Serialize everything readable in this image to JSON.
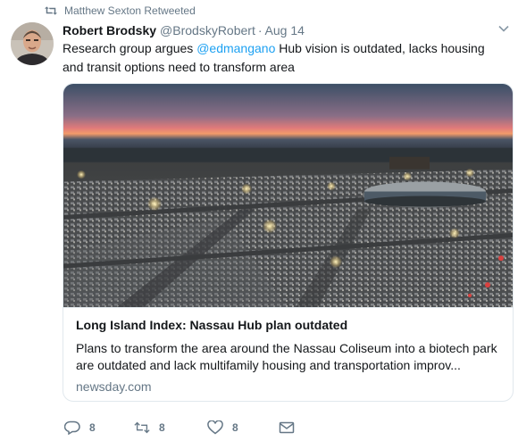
{
  "retweet_context": {
    "text": "Matthew Sexton Retweeted",
    "icon": "retweet-icon"
  },
  "tweet": {
    "author": {
      "fullname": "Robert Brodsky",
      "handle": "@BrodskyRobert"
    },
    "separator": "·",
    "time": "Aug 14",
    "text_before": "Research group argues ",
    "mention": "@edmangano",
    "text_after": " Hub vision is outdated, lacks housing and transit options need to transform area"
  },
  "card": {
    "title": "Long Island Index: Nassau Hub plan outdated",
    "description": "Plans to transform the area around the Nassau Coliseum into a biotech park are outdated and lack multifamily housing and transportation improv...",
    "domain": "newsday.com"
  },
  "actions": {
    "reply_count": "8",
    "retweet_count": "8",
    "like_count": "8"
  },
  "colors": {
    "accent": "#1da1f2",
    "muted": "#657786",
    "border": "#e1e8ed",
    "text": "#14171a"
  }
}
